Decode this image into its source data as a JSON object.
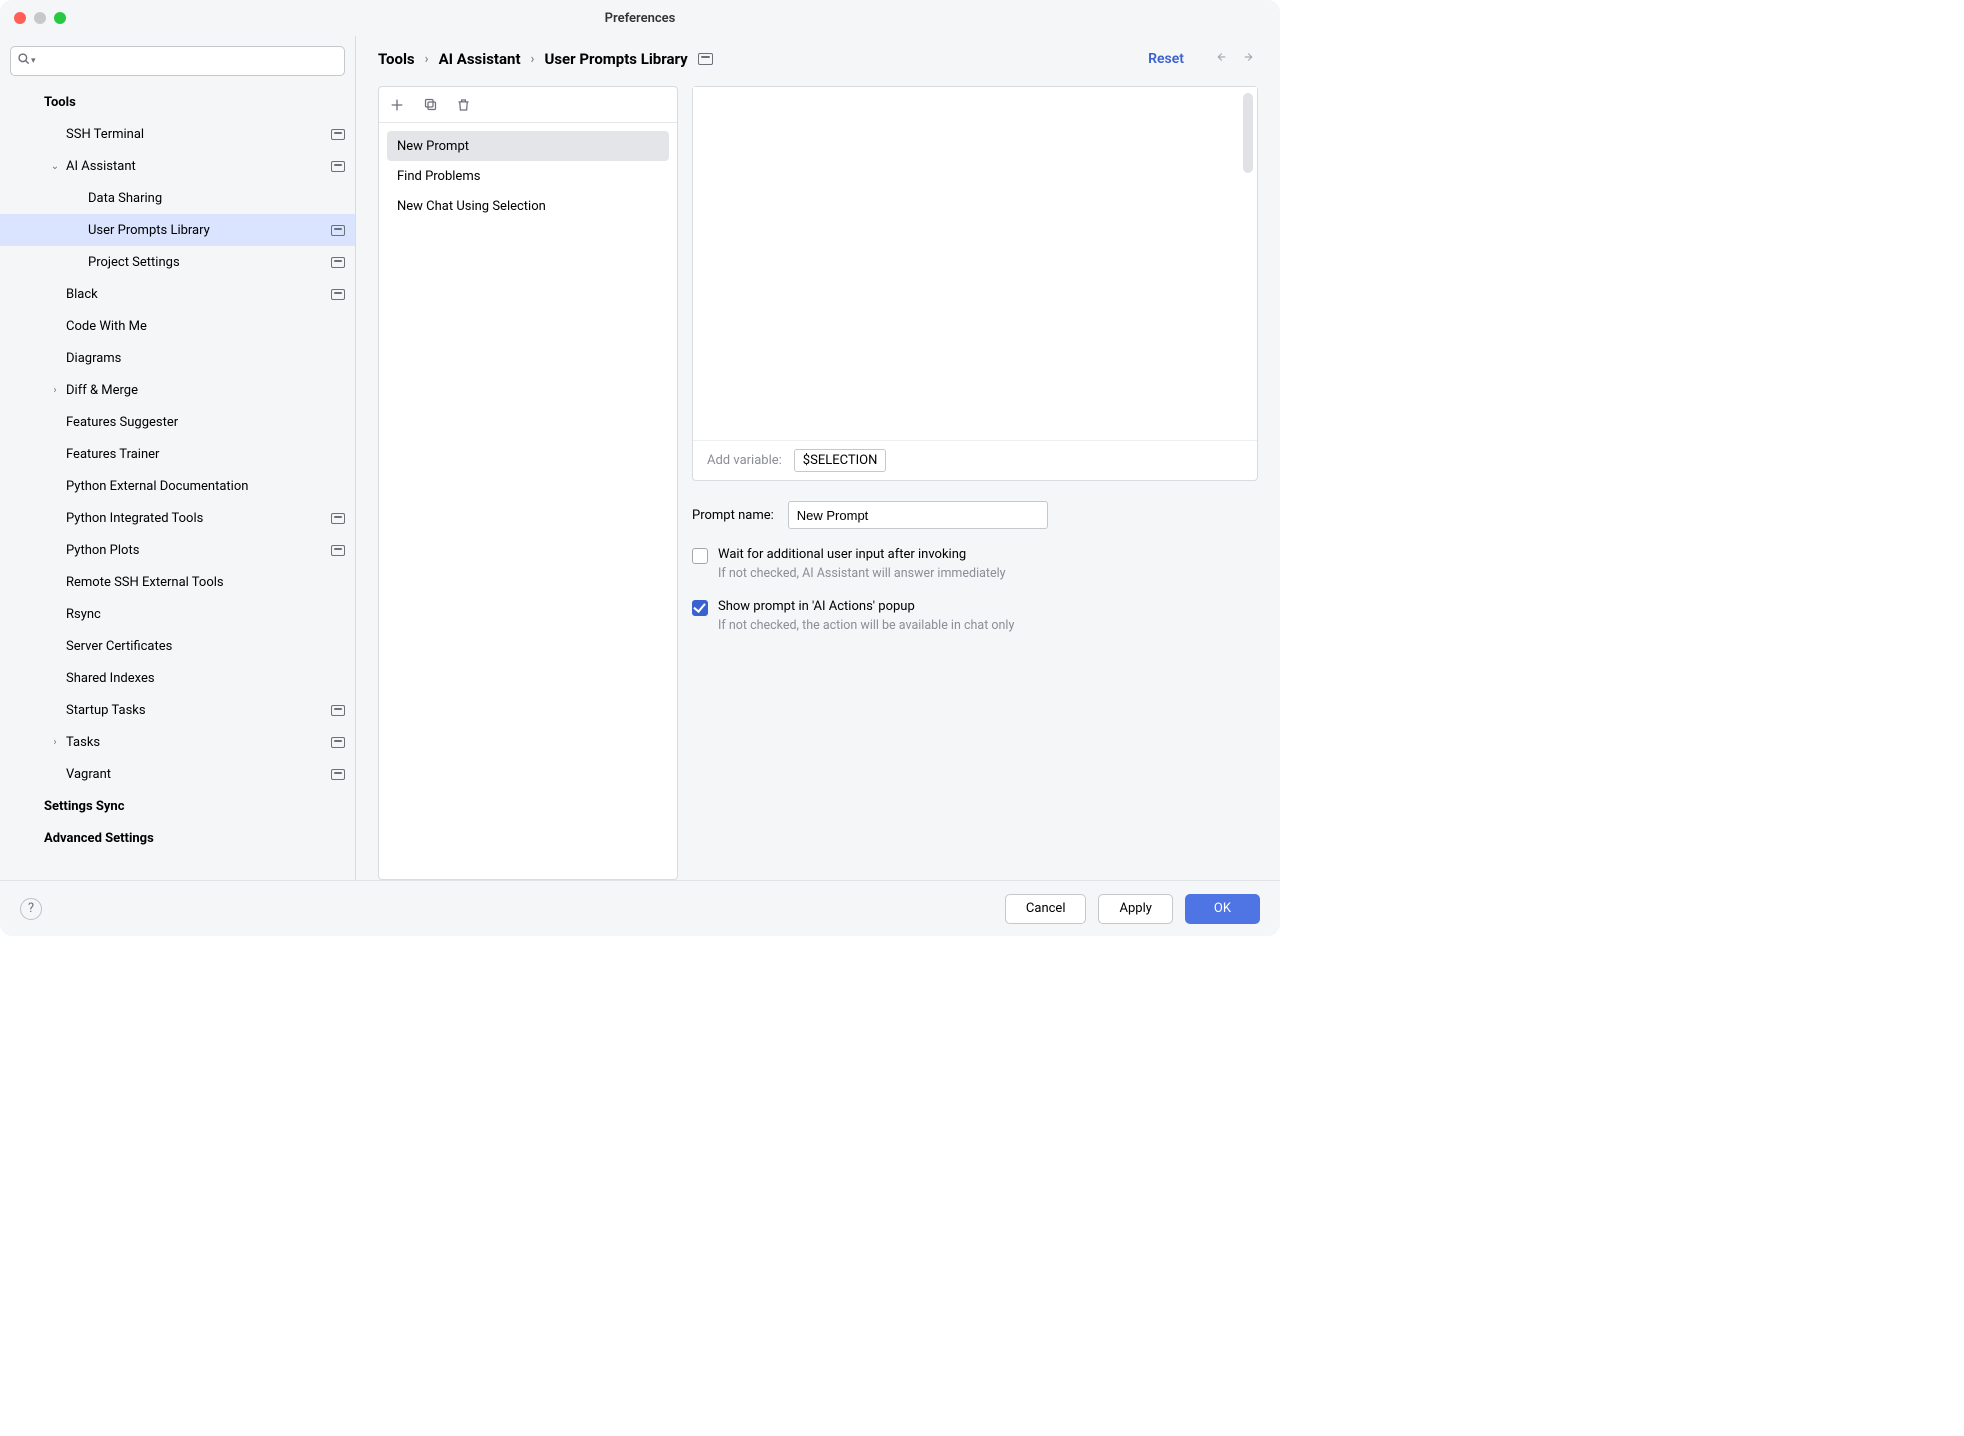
{
  "title": "Preferences",
  "search": {
    "value": ""
  },
  "tree": [
    {
      "label": "Tools",
      "indent": 0,
      "bold": true,
      "arrow": "",
      "badge": false,
      "selected": false
    },
    {
      "label": "SSH Terminal",
      "indent": 1,
      "bold": false,
      "arrow": "",
      "badge": true,
      "selected": false
    },
    {
      "label": "AI Assistant",
      "indent": 1,
      "bold": false,
      "arrow": "v",
      "badge": true,
      "selected": false
    },
    {
      "label": "Data Sharing",
      "indent": 2,
      "bold": false,
      "arrow": "",
      "badge": false,
      "selected": false
    },
    {
      "label": "User Prompts Library",
      "indent": 2,
      "bold": false,
      "arrow": "",
      "badge": true,
      "selected": true
    },
    {
      "label": "Project Settings",
      "indent": 2,
      "bold": false,
      "arrow": "",
      "badge": true,
      "selected": false
    },
    {
      "label": "Black",
      "indent": 1,
      "bold": false,
      "arrow": "",
      "badge": true,
      "selected": false
    },
    {
      "label": "Code With Me",
      "indent": 1,
      "bold": false,
      "arrow": "",
      "badge": false,
      "selected": false
    },
    {
      "label": "Diagrams",
      "indent": 1,
      "bold": false,
      "arrow": "",
      "badge": false,
      "selected": false
    },
    {
      "label": "Diff & Merge",
      "indent": 1,
      "bold": false,
      "arrow": ">",
      "badge": false,
      "selected": false
    },
    {
      "label": "Features Suggester",
      "indent": 1,
      "bold": false,
      "arrow": "",
      "badge": false,
      "selected": false
    },
    {
      "label": "Features Trainer",
      "indent": 1,
      "bold": false,
      "arrow": "",
      "badge": false,
      "selected": false
    },
    {
      "label": "Python External Documentation",
      "indent": 1,
      "bold": false,
      "arrow": "",
      "badge": false,
      "selected": false
    },
    {
      "label": "Python Integrated Tools",
      "indent": 1,
      "bold": false,
      "arrow": "",
      "badge": true,
      "selected": false
    },
    {
      "label": "Python Plots",
      "indent": 1,
      "bold": false,
      "arrow": "",
      "badge": true,
      "selected": false
    },
    {
      "label": "Remote SSH External Tools",
      "indent": 1,
      "bold": false,
      "arrow": "",
      "badge": false,
      "selected": false
    },
    {
      "label": "Rsync",
      "indent": 1,
      "bold": false,
      "arrow": "",
      "badge": false,
      "selected": false
    },
    {
      "label": "Server Certificates",
      "indent": 1,
      "bold": false,
      "arrow": "",
      "badge": false,
      "selected": false
    },
    {
      "label": "Shared Indexes",
      "indent": 1,
      "bold": false,
      "arrow": "",
      "badge": false,
      "selected": false
    },
    {
      "label": "Startup Tasks",
      "indent": 1,
      "bold": false,
      "arrow": "",
      "badge": true,
      "selected": false
    },
    {
      "label": "Tasks",
      "indent": 1,
      "bold": false,
      "arrow": ">",
      "badge": true,
      "selected": false
    },
    {
      "label": "Vagrant",
      "indent": 1,
      "bold": false,
      "arrow": "",
      "badge": true,
      "selected": false
    },
    {
      "label": "Settings Sync",
      "indent": 0,
      "bold": true,
      "arrow": "",
      "badge": false,
      "selected": false
    },
    {
      "label": "Advanced Settings",
      "indent": 0,
      "bold": true,
      "arrow": "",
      "badge": false,
      "selected": false
    }
  ],
  "breadcrumbs": [
    "Tools",
    "AI Assistant",
    "User Prompts Library"
  ],
  "reset_label": "Reset",
  "prompts": [
    {
      "label": "New Prompt",
      "selected": true
    },
    {
      "label": "Find Problems",
      "selected": false
    },
    {
      "label": "New Chat Using Selection",
      "selected": false
    }
  ],
  "editor": {
    "content": "",
    "add_variable_label": "Add variable:",
    "variable_button": "$SELECTION"
  },
  "form": {
    "prompt_name_label": "Prompt name:",
    "prompt_name_value": "New Prompt",
    "wait_checkbox": {
      "checked": false,
      "label": "Wait for additional user input after invoking",
      "hint": "If not checked, AI Assistant will answer immediately"
    },
    "show_checkbox": {
      "checked": true,
      "label": "Show prompt in 'AI Actions' popup",
      "hint": "If not checked, the action will be available in chat only"
    }
  },
  "footer": {
    "cancel": "Cancel",
    "apply": "Apply",
    "ok": "OK"
  }
}
